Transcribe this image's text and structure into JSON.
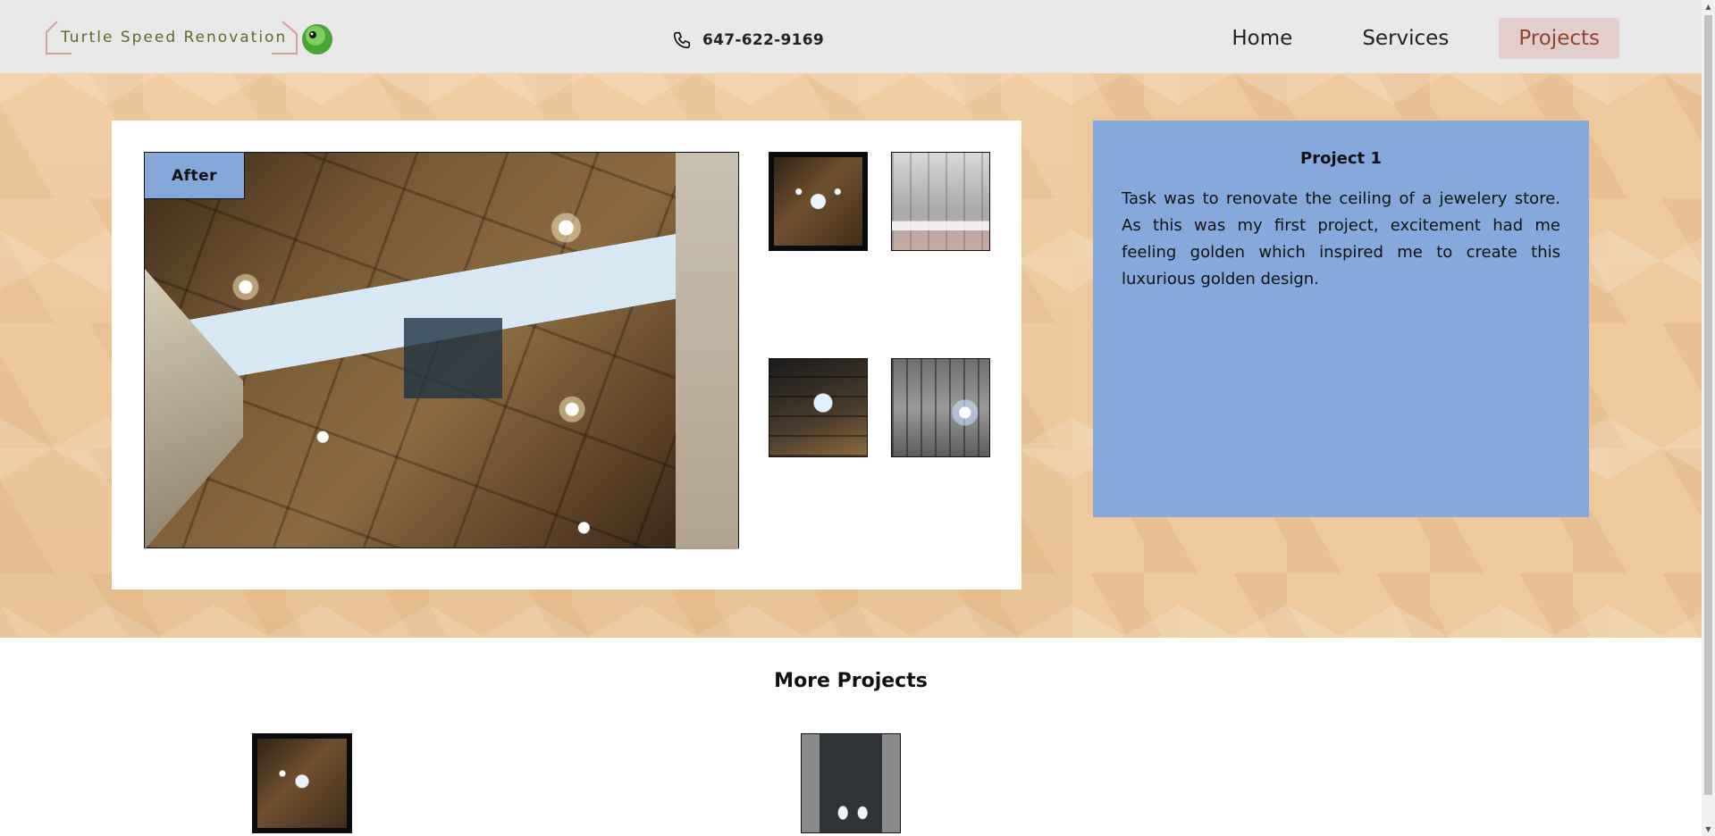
{
  "header": {
    "brand": "Turtle Speed Renovation",
    "phone": "647-622-9169",
    "nav": [
      {
        "label": "Home"
      },
      {
        "label": "Services"
      },
      {
        "label": "Projects"
      }
    ]
  },
  "gallery": {
    "badge": "After",
    "thumbnail_count": 4
  },
  "project": {
    "title": "Project 1",
    "description": "Task was to renovate the ceiling of a jewelery store. As this was my first project, excitement had me feeling golden which inspired me to create this luxurious golden design."
  },
  "more": {
    "title": "More Projects"
  },
  "colors": {
    "header_bg": "#e8e8e8",
    "active_nav_bg": "#e2cfcc",
    "active_nav_text": "#8c4630",
    "info_card_bg": "#86a8dc",
    "badge_bg": "#85a8db",
    "hero_bg": "#edc99d",
    "brand_text": "#5c6b2d"
  },
  "icons": {
    "phone": "phone-icon",
    "logo": "turtle-logo-icon"
  }
}
